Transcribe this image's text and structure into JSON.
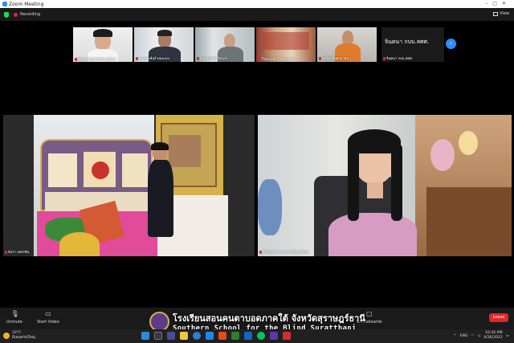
{
  "window": {
    "title": "Zoom Meeting"
  },
  "topbar": {
    "recording_label": "Recording",
    "view_label": "View"
  },
  "participants": [
    {
      "name": "Varut Supthuthangkun",
      "bg": "#e8e8e8"
    },
    {
      "name": "ดร.ประพันธ์ ทองแดง",
      "bg": "#d8dde4"
    },
    {
      "name": "นายสมชาย วิศวกร",
      "bg": "#cfd6da"
    },
    {
      "name": "Thitimon Thitisatoon",
      "bg": "#7a5d48"
    },
    {
      "name": "ชลันธ์ ติดต่อกาสุข",
      "bg": "#c6c4c0"
    }
  ],
  "namecard": {
    "display": "จินตนา กบบ.สศศ.",
    "name": "จินตนา กบบ.สศศ."
  },
  "main_videos": [
    {
      "name": "นิสรา เพชรชิน"
    },
    {
      "name": "สำนักบริหารงานการศึกษาพิเศษ"
    }
  ],
  "controls": {
    "unmute": "Unmute",
    "start_video": "Start Video",
    "whiteboards": "Whiteboards",
    "leave": "Leave"
  },
  "subtitle": {
    "thai": "โรงเรียนสอนคนตาบอดภาคใต้ จังหวัดสุราษฎร์ธานี",
    "english": "Southern School for the Blind Suratthani"
  },
  "taskbar": {
    "temp": "33°C",
    "weather": "มีเมฆส่วนใหญ่",
    "lang": "ENG",
    "time": "10:34 AM",
    "date": "4/26/2022"
  },
  "colors": {
    "accent": "#2d8cff",
    "leave": "#e02828",
    "mic_muted": "#e02828"
  }
}
